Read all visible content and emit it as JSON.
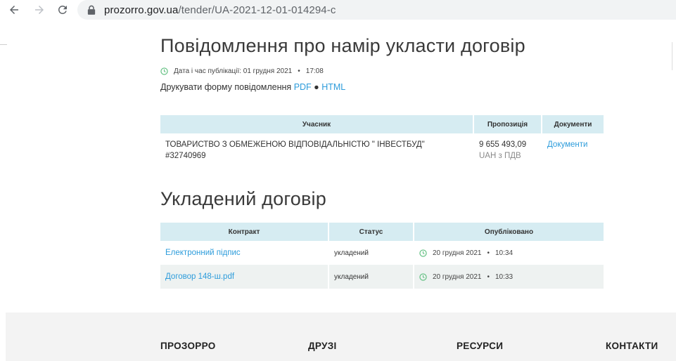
{
  "browser": {
    "url_host": "prozorro.gov.ua",
    "url_path": "/tender/UA-2021-12-01-014294-c"
  },
  "notice": {
    "title": "Повідомлення про намір укласти договір",
    "published_label": "Дата і час публікації: 01 грудня 2021",
    "published_time": "17:08",
    "print_label": "Друкувати форму повідомлення",
    "print_pdf": "PDF",
    "print_sep": "●",
    "print_html": "HTML"
  },
  "participants_table": {
    "headers": [
      "Учасник",
      "Пропозиція",
      "Документи"
    ],
    "rows": [
      {
        "name": "ТОВАРИСТВО З ОБМЕЖЕНОЮ ВІДПОВІДАЛЬНІСТЮ \" ІНВЕСТБУД\"",
        "id": "#32740969",
        "amount": "9 655 493,09",
        "currency": "UAH з ПДВ",
        "docs": "Документи"
      }
    ]
  },
  "contract": {
    "title": "Укладений договір",
    "headers": [
      "Контракт",
      "Статус",
      "Опубліковано"
    ],
    "rows": [
      {
        "name": "Електронний підпис",
        "status": "укладений",
        "date": "20 грудня 2021",
        "time": "10:34"
      },
      {
        "name": "Договор 148-ш.pdf",
        "status": "укладений",
        "date": "20 грудня 2021",
        "time": "10:33"
      }
    ]
  },
  "footer": {
    "items": [
      "ПРОЗОРРО",
      "ДРУЗІ",
      "РЕСУРСИ",
      "КОНТАКТИ"
    ]
  },
  "colors": {
    "accent": "#2d9cdb",
    "header_bg": "#d6ecf2",
    "clock_green": "#5fbf7f"
  }
}
